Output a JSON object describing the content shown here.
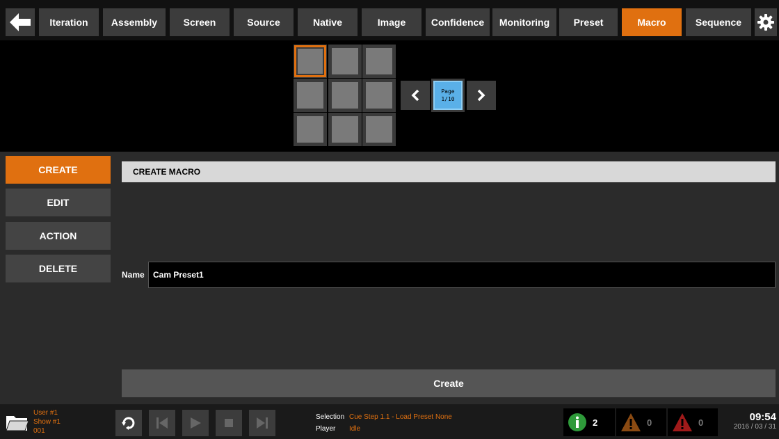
{
  "nav": {
    "tabs": [
      {
        "label": "Iteration",
        "active": false
      },
      {
        "label": "Assembly",
        "active": false
      },
      {
        "label": "Screen",
        "active": false
      },
      {
        "label": "Source",
        "active": false
      },
      {
        "label": "Native",
        "active": false
      },
      {
        "label": "Image",
        "active": false
      },
      {
        "label": "Confidence",
        "active": false
      },
      {
        "label": "Monitoring",
        "active": false
      },
      {
        "label": "Preset",
        "active": false
      },
      {
        "label": "Macro",
        "active": true
      },
      {
        "label": "Sequence",
        "active": false
      }
    ],
    "icons": {
      "back": "arrow-left-icon",
      "settings": "gear-icon"
    }
  },
  "grid": {
    "selected_index": 0,
    "page_label": "Page",
    "page_value": "1/10"
  },
  "sidebar": {
    "items": [
      {
        "label": "CREATE",
        "active": true
      },
      {
        "label": "EDIT",
        "active": false
      },
      {
        "label": "ACTION",
        "active": false
      },
      {
        "label": "DELETE",
        "active": false
      }
    ]
  },
  "panel": {
    "header": "CREATE MACRO",
    "name_label": "Name",
    "name_value": "Cam Preset1",
    "create_label": "Create"
  },
  "footer": {
    "user": "User #1",
    "show": "Show #1",
    "number": "001",
    "selection_key": "Selection",
    "selection_value": "Cue Step 1.1 - Load Preset None",
    "player_key": "Player",
    "player_value": "Idle",
    "info_count": "2",
    "warning_count": "0",
    "error_count": "0",
    "time": "09:54",
    "date": "2016 / 03 / 31"
  },
  "colors": {
    "accent": "#e07010",
    "page_box": "#5ab0e8",
    "info": "#2e9a3a",
    "warning": "#8a4a12",
    "error": "#a01a1a"
  }
}
